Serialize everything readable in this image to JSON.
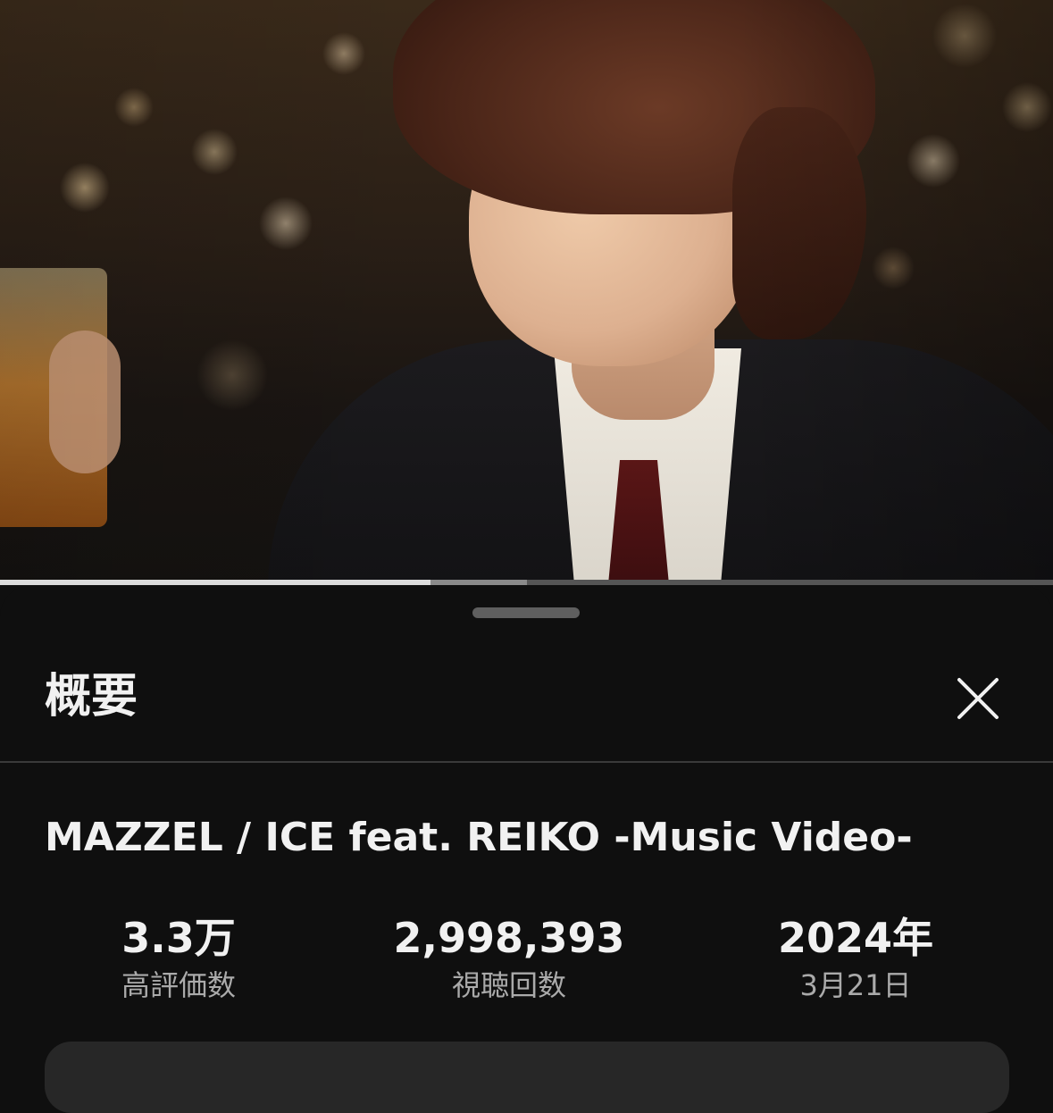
{
  "player": {
    "progress_played_fraction": 0.409,
    "progress_buffered_fraction": 0.5
  },
  "sheet": {
    "title": "概要",
    "close_icon": "close-icon"
  },
  "video": {
    "title": "MAZZEL / ICE feat. REIKO -Music Video-"
  },
  "stats": {
    "likes": {
      "value": "3.3万",
      "label": "高評価数"
    },
    "views": {
      "value": "2,998,393",
      "label": "視聴回数"
    },
    "date": {
      "value": "2024年",
      "label": "3月21日"
    }
  },
  "colors": {
    "background": "#0f0f0f",
    "primary_text": "#f1f1f1",
    "secondary_text": "#aaaaaa",
    "divider": "#3a3a3a",
    "progress_played": "#dcdcdc",
    "progress_track": "#555555"
  }
}
